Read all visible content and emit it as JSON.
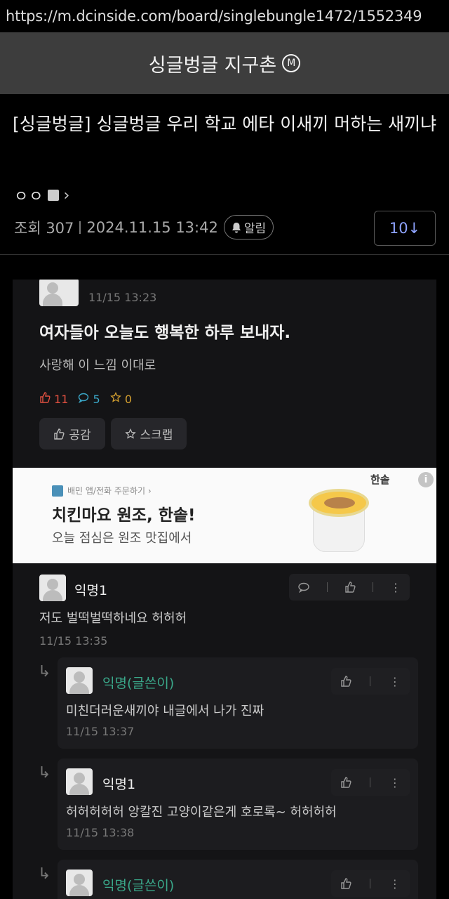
{
  "browser": {
    "url": "https://m.dcinside.com/board/singlebungle1472/1552349"
  },
  "gallery": {
    "name": "싱글벙글 지구촌",
    "badge": "M"
  },
  "post": {
    "title": "[싱글벙글] 싱글벙글 우리 학교 에타 이새끼 머하는 새끼냐",
    "author": "ㅇㅇ",
    "views": "조회 307",
    "datetime": "2024.11.15 13:42",
    "alarm_label": "알림",
    "comment_count": "10↓"
  },
  "capture": {
    "post": {
      "time": "11/15 13:23",
      "title": "여자들아 오늘도 행복한 하루 보내자.",
      "body": "사랑해 이 느낌 이대로",
      "likes": "11",
      "comments": "5",
      "scraps": "0",
      "like_button": "공감",
      "scrap_button": "스크랩"
    },
    "ad": {
      "source": "배민 앱/전화 주문하기 ›",
      "title": "치킨마요 원조, 한솥!",
      "subtitle": "오늘 점심은 원조 맛집에서",
      "brand": "한솥",
      "info_icon": "i"
    },
    "comments": [
      {
        "nick": "익명1",
        "body": "저도 벌떡벌떡하네요 허허허",
        "time": "11/15 13:35"
      },
      {
        "nick": "익명(글쓴이)",
        "body": "미친더러운새끼야 내글에서 나가 진짜",
        "time": "11/15 13:37"
      },
      {
        "nick": "익명1",
        "body": "허허허허허 앙칼진 고양이같은게 호로록~ 허허허허",
        "time": "11/15 13:38"
      },
      {
        "nick": "익명(글쓴이)"
      }
    ]
  },
  "icons": {
    "reply_arrow": "↳",
    "like": "👍",
    "more": "⋮",
    "chevron": "›"
  }
}
